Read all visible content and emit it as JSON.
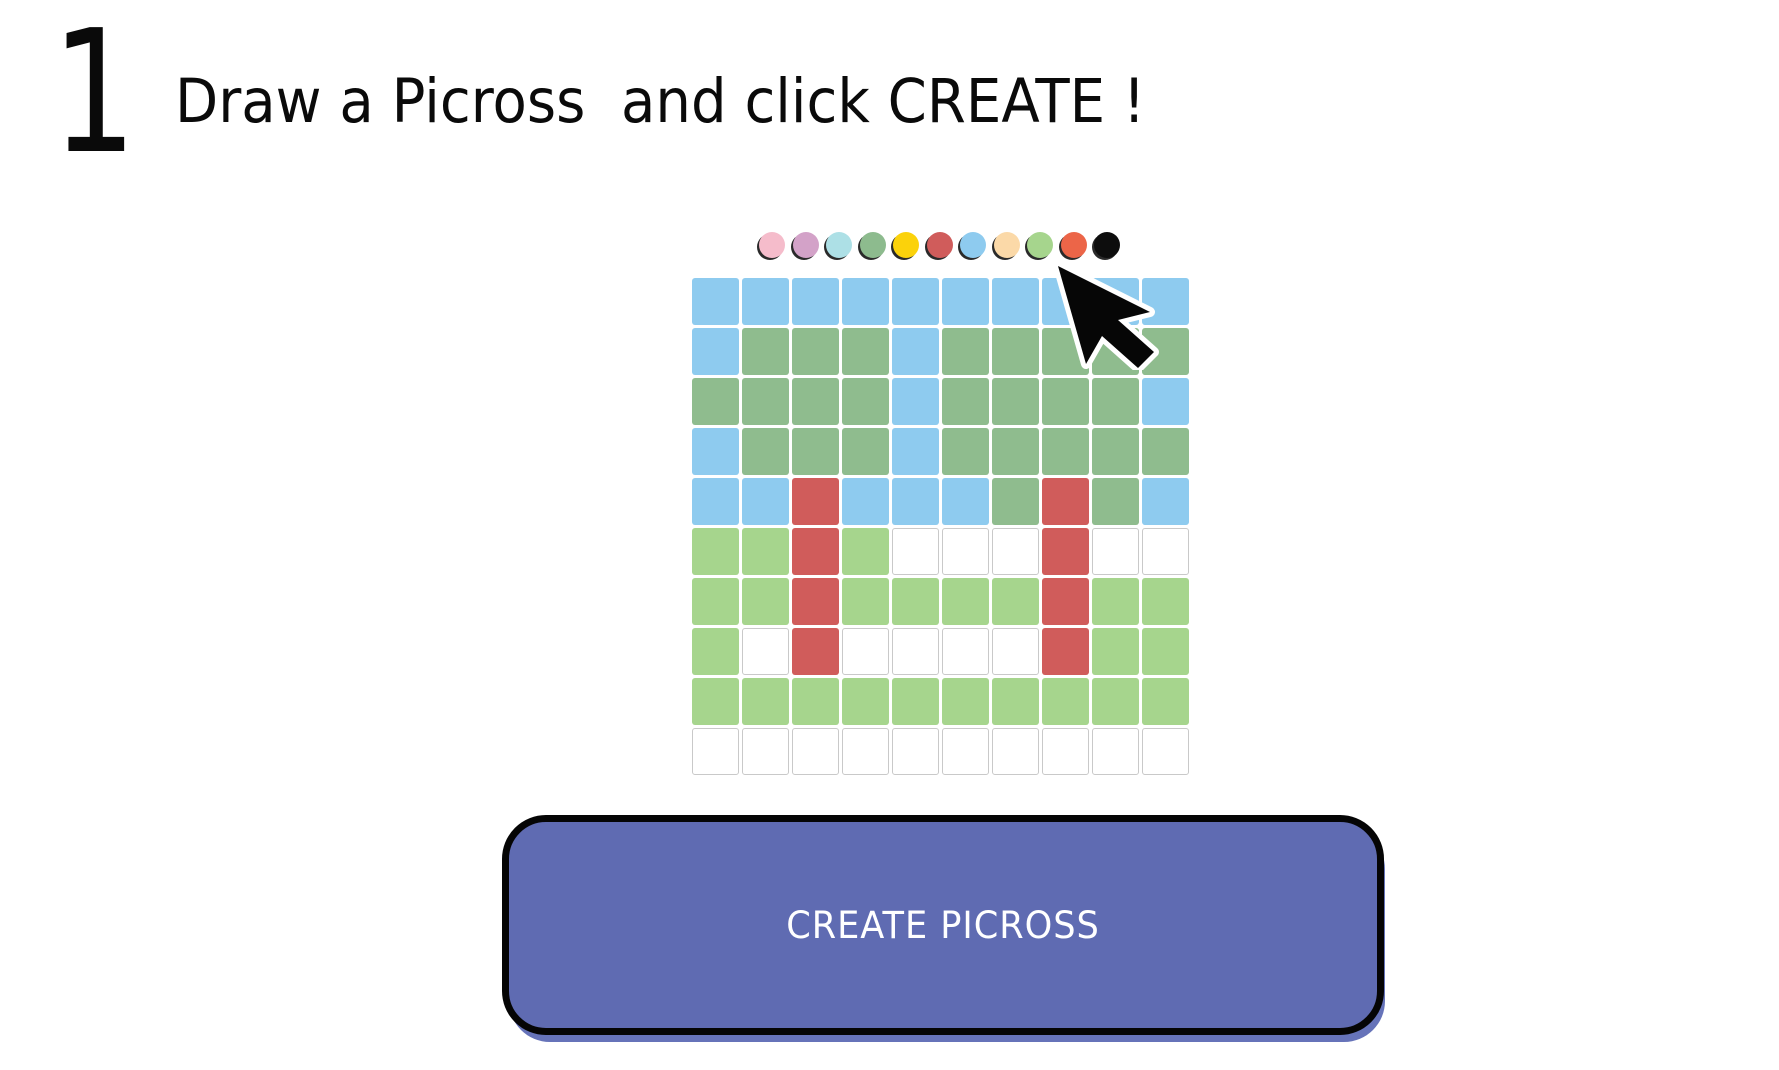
{
  "step": {
    "number": "1",
    "instruction": "Draw a Picross  and click CREATE !"
  },
  "palette": {
    "colors": [
      "#f5bccb",
      "#d3a2c8",
      "#ade0e6",
      "#8dbb8e",
      "#fbd20b",
      "#d05c5b",
      "#8ecbef",
      "#fbd9a8",
      "#a6d58d",
      "#ec6548",
      "#0d0d0d"
    ],
    "names": [
      "pink",
      "lilac",
      "light-cyan",
      "sage-green",
      "yellow",
      "red",
      "sky-blue",
      "peach",
      "light-green",
      "orange-red",
      "black"
    ]
  },
  "grid": {
    "colors": {
      "W": "#ffffff",
      "B": "#8ecbef",
      "G": "#8fbc8e",
      "L": "#a6d58d",
      "R": "#d05c5b"
    },
    "rows": [
      "BBBBBBBBBB",
      "BGGGBGGGGG",
      "GGGGBGGGGB",
      "BGGGBGGGGG",
      "BBRBBBGRGB",
      "LLRLWWWRWW",
      "LLRLLLLRLL",
      "LWRWWWWRLL",
      "LLLLLLLLLL",
      "WWWWWWWWWW"
    ]
  },
  "cursor": {
    "icon": "arrow-cursor-icon"
  },
  "create_button": {
    "label": "CREATE PICROSS",
    "color": "#5f6bb2"
  }
}
